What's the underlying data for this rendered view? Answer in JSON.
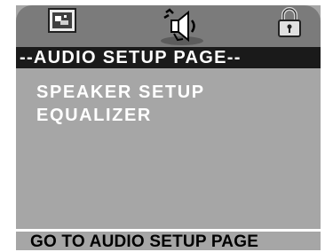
{
  "icons": [
    "general-setup-icon",
    "audio-setup-icon",
    "lock-icon"
  ],
  "header": {
    "title": "--AUDIO SETUP PAGE--"
  },
  "menu": {
    "items": [
      {
        "label": "SPEAKER SETUP"
      },
      {
        "label": "EQUALIZER"
      }
    ]
  },
  "footer": {
    "hint": "GO TO AUDIO SETUP PAGE"
  },
  "colors": {
    "panel": "#a6a6a6",
    "icon_bar": "#7b7b7b",
    "header_bg": "#1a1a1a",
    "text": "#ffffff"
  }
}
